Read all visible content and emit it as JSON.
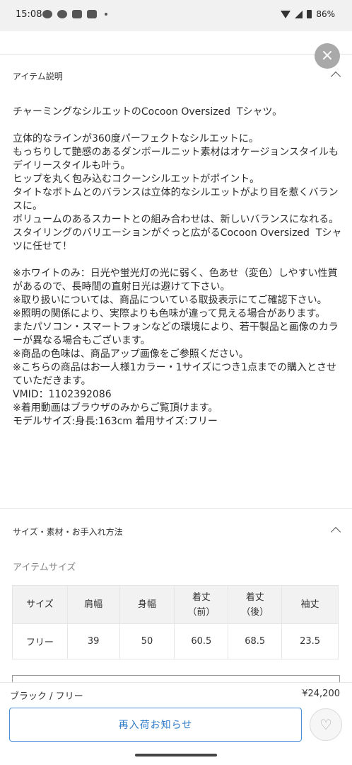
{
  "status": {
    "time": "15:08",
    "battery": "86%"
  },
  "item_description": {
    "heading": "アイテム説明",
    "body": "チャーミングなシルエットのCocoon Oversized  Tシャツ。\n\n立体的なラインが360度パーフェクトなシルエットに。\nもっちりして艶感のあるダンボールニット素材はオケージョンスタイルもデイリースタイルも叶う。\nヒップを丸く包み込むコクーンシルエットがポイント。\nタイトなボトムとのバランスは立体的なシルエットがより目を惹くバランスに。\nボリュームのあるスカートとの組み合わせは、新しいバランスになれる。\nスタイリングのバリエーションがぐっと広がるCocoon Oversized  Tシャツに任せて！\n\n※ホワイトのみ：日光や蛍光灯の光に弱く、色あせ（変色）しやすい性質があるので、長時間の直射日光は避けて下さい。\n※取り扱いについては、商品についている取扱表示にてご確認下さい。\n※照明の関係により、実際よりも色味が違って見える場合があります。\nまたパソコン・スマートフォンなどの環境により、若干製品と画像のカラーが異なる場合もございます。\n※商品の色味は、商品アップ画像をご参照ください。\n※こちらの商品はお一人様1カラー・1サイズにつき1点までの購入とさせていただきます。\nVMID：1102392086\n※着用動画はブラウザのみからご覧頂けます。\nモデルサイズ:身長:163cm 着用サイズ:フリー"
  },
  "size_section": {
    "heading": "サイズ・素材・お手入れ方法",
    "subheading": "アイテムサイズ",
    "table": {
      "headers": [
        "サイズ",
        "肩幅",
        "身幅",
        "着丈\n（前）",
        "着丈\n（後）",
        "袖丈"
      ],
      "rows": [
        [
          "フリー",
          "39",
          "50",
          "60.5",
          "68.5",
          "23.5"
        ]
      ]
    }
  },
  "bottom_bar": {
    "variant": "ブラック / フリー",
    "price": "¥24,200",
    "restock_label": "再入荷お知らせ"
  },
  "icons": {
    "close": "close-icon",
    "chevron": "chevron-up-icon",
    "favorite": "heart-icon"
  },
  "colors": {
    "accent": "#2f7cc9",
    "close_bg": "#a9a9a9"
  }
}
